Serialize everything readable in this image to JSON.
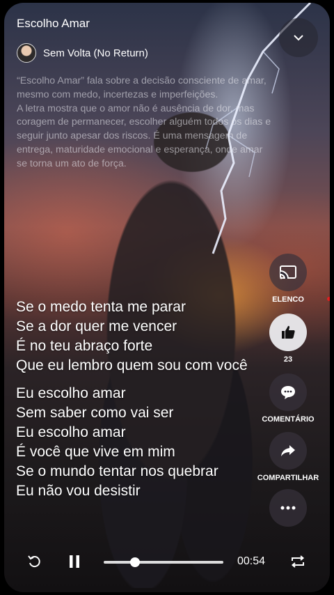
{
  "header": {
    "title": "Escolho Amar"
  },
  "artist": {
    "name": "Sem Volta (No Return)"
  },
  "description": [
    "“Escolho Amar” fala sobre a decisão consciente de amar, mesmo com medo, incertezas e imperfeições.",
    "A letra mostra que o amor não é ausência de dor, mas coragem de permanecer, escolher alguém todos os dias e seguir junto apesar dos riscos. É uma mensagem de entrega, maturidade emocional e esperança, onde amar se torna um ato de força."
  ],
  "lyrics": {
    "stanza1": [
      "Se o medo tenta me parar",
      "Se a dor quer me vencer",
      "É no teu abraço forte",
      "Que eu lembro quem sou com você"
    ],
    "stanza2": [
      "Eu escolho amar",
      "Sem saber como vai ser",
      "Eu escolho amar",
      "É você que vive em mim",
      "Se o mundo tentar nos quebrar",
      "Eu não vou desistir"
    ]
  },
  "actions": {
    "cast_label": "ELENCO",
    "like_count": "23",
    "comment_label": "COMENTÁRIO",
    "share_label": "COMPARTILHAR"
  },
  "player": {
    "time": "00:54",
    "progress": 0.26
  },
  "icons": [
    "chevron-down-icon",
    "cast-icon",
    "thumbs-up-icon",
    "comment-icon",
    "share-icon",
    "more-icon",
    "replay-icon",
    "pause-icon",
    "repeat-icon"
  ]
}
